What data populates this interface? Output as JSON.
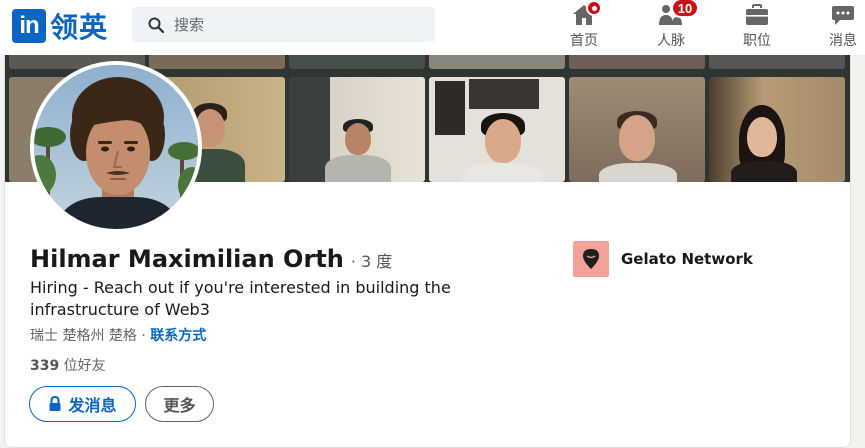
{
  "brand": {
    "logo_mark": "in",
    "logo_text": "领英",
    "accent": "#0a66c2"
  },
  "search": {
    "placeholder": "搜索",
    "icon": "search-icon"
  },
  "nav": {
    "home": {
      "label": "首页",
      "icon": "home-icon",
      "badge": ""
    },
    "network": {
      "label": "人脉",
      "icon": "people-icon",
      "badge": "10"
    },
    "jobs": {
      "label": "职位",
      "icon": "briefcase-icon"
    },
    "messaging": {
      "label": "消息",
      "icon": "chat-icon"
    }
  },
  "profile": {
    "name": "Hilmar Maximilian Orth",
    "degree": "· 3 度",
    "headline": "Hiring - Reach out if you're interested in building the infrastructure of Web3",
    "location": "瑞士 楚格州 楚格 · ",
    "contact_info": "联系方式",
    "connections_count": "339",
    "connections_label": " 位好友",
    "buttons": {
      "message": "发消息",
      "more": "更多"
    },
    "company": {
      "name": "Gelato Network",
      "logo_color": "#f4a299"
    }
  },
  "colors": {
    "badge": "#cc1016",
    "banner": "#2e3532"
  }
}
